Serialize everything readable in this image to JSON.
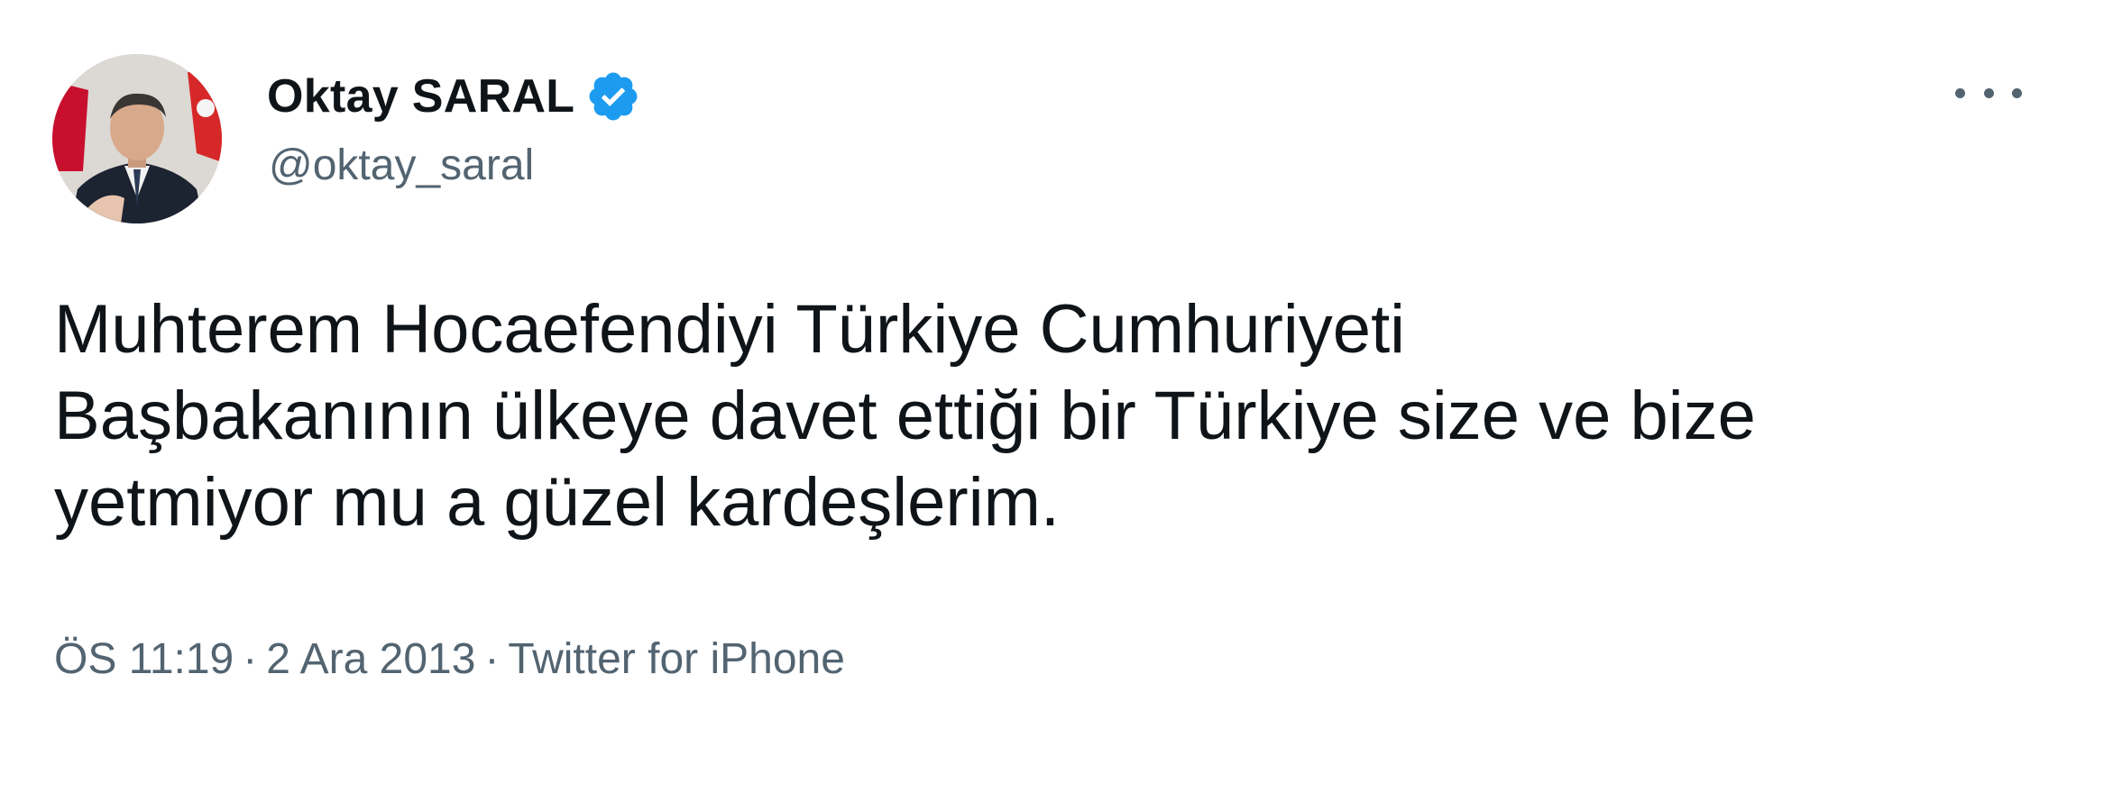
{
  "author": {
    "display_name": "Oktay SARAL",
    "handle": "@oktay_saral",
    "verified": true,
    "verified_icon": "verified-badge-icon"
  },
  "tweet": {
    "lines": [
      "Muhterem Hocaefendiyi Türkiye Cumhuriyeti",
      "Başbakanının ülkeye davet ettiği bir Türkiye size ve bize",
      "yetmiyor mu a güzel kardeşlerim."
    ]
  },
  "meta": {
    "time": "ÖS 11:19",
    "separator": "·",
    "date": "2 Ara 2013",
    "source": "Twitter for iPhone"
  },
  "colors": {
    "text": "#0f1419",
    "secondary": "#536471",
    "verified_blue": "#1d9bf0",
    "background": "#ffffff"
  }
}
